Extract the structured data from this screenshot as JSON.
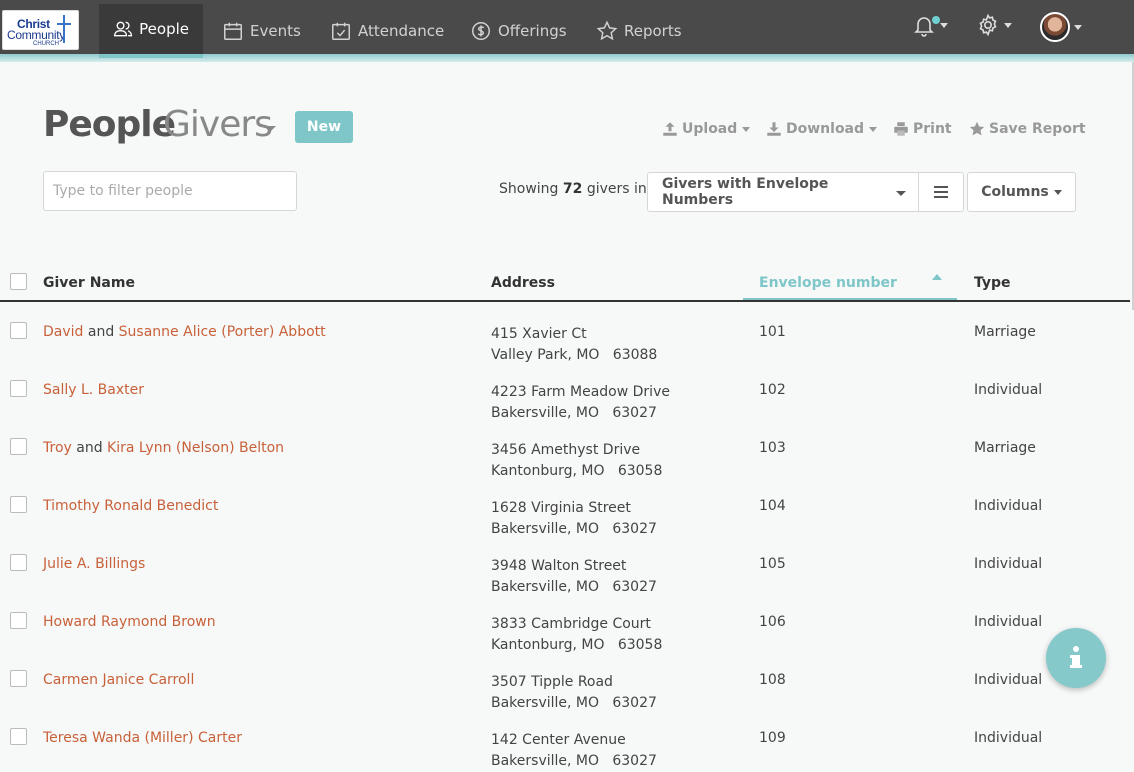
{
  "logo": {
    "line1": "Christ",
    "line2": "Community",
    "line3": "CHURCH"
  },
  "nav": {
    "people": "People",
    "events": "Events",
    "attendance": "Attendance",
    "offerings": "Offerings",
    "reports": "Reports"
  },
  "header": {
    "title": "People",
    "subtitle": "Givers",
    "new_label": "New"
  },
  "actions": {
    "upload": "Upload",
    "download": "Download",
    "print": "Print",
    "save_report": "Save Report"
  },
  "filter": {
    "placeholder": "Type to filter people"
  },
  "summary": {
    "prefix": "Showing",
    "count": "72",
    "suffix": "givers in"
  },
  "report_select": {
    "value": "Givers with Envelope Numbers"
  },
  "columns_label": "Columns",
  "table": {
    "headers": {
      "name": "Giver Name",
      "address": "Address",
      "envelope": "Envelope number",
      "type": "Type"
    },
    "rows": [
      {
        "first": "David",
        "joiner": " and ",
        "second": "Susanne Alice (Porter) Abbott",
        "address": "415 Xavier Ct\nValley Park, MO   63088",
        "envelope": "101",
        "type": "Marriage"
      },
      {
        "first": "Sally L. Baxter",
        "joiner": "",
        "second": "",
        "address": "4223 Farm Meadow Drive\nBakersville, MO   63027",
        "envelope": "102",
        "type": "Individual"
      },
      {
        "first": "Troy",
        "joiner": " and ",
        "second": "Kira Lynn (Nelson) Belton",
        "address": "3456 Amethyst Drive\nKantonburg, MO   63058",
        "envelope": "103",
        "type": "Marriage"
      },
      {
        "first": "Timothy Ronald Benedict",
        "joiner": "",
        "second": "",
        "address": "1628 Virginia Street\nBakersville, MO   63027",
        "envelope": "104",
        "type": "Individual"
      },
      {
        "first": "Julie A. Billings",
        "joiner": "",
        "second": "",
        "address": "3948 Walton Street\nBakersville, MO   63027",
        "envelope": "105",
        "type": "Individual"
      },
      {
        "first": "Howard Raymond Brown",
        "joiner": "",
        "second": "",
        "address": "3833 Cambridge Court\nKantonburg, MO   63058",
        "envelope": "106",
        "type": "Individual"
      },
      {
        "first": "Carmen Janice Carroll",
        "joiner": "",
        "second": "",
        "address": "3507 Tipple Road\nBakersville, MO   63027",
        "envelope": "108",
        "type": "Individual"
      },
      {
        "first": "Teresa Wanda (Miller) Carter",
        "joiner": "",
        "second": "",
        "address": "142 Center Avenue\nBakersville, MO   63027",
        "envelope": "109",
        "type": "Individual"
      }
    ]
  },
  "colors": {
    "accent": "#7ec6c8",
    "link": "#c8613a",
    "nav_bg": "#4a4a4a"
  },
  "icons": {
    "people": "people-icon",
    "events": "calendar-icon",
    "attendance": "checklist-icon",
    "offerings": "dollar-icon",
    "reports": "star-icon",
    "notifications": "bell-icon",
    "settings": "gear-icon",
    "info": "info-icon"
  }
}
